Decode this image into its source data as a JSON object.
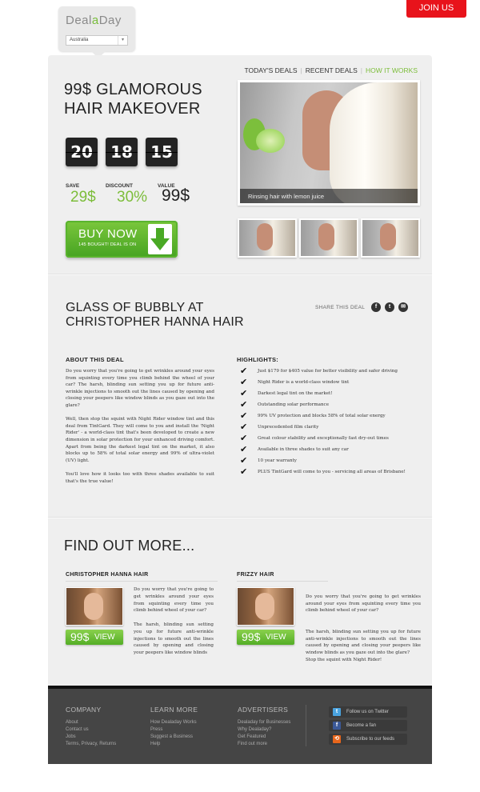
{
  "header": {
    "join_label": "JOIN US",
    "logo_part1": "Deal",
    "logo_part2": "a",
    "logo_part3": "Day",
    "country": "Australia"
  },
  "nav": {
    "items": [
      "TODAY'S DEALS",
      "RECENT DEALS",
      "HOW IT WORKS"
    ],
    "active_color": "#7cbd3a"
  },
  "deal": {
    "title": "99$ GLAMOROUS HAIR MAKEOVER",
    "timer": [
      "20",
      "18",
      "15"
    ],
    "save_label": "SAVE",
    "save_value": "29$",
    "discount_label": "DISCOUNT",
    "discount_value": "30%",
    "value_label": "VALUE",
    "value_value": "99$",
    "buy_label": "BUY NOW",
    "buy_sub": "145 BOUGHT! DEAL IS ON",
    "image_caption": "Rinsing hair with lemon juice"
  },
  "detail": {
    "title": "GLASS OF BUBBLY AT CHRISTOPHER HANNA HAIR",
    "share_label": "SHARE THIS DEAL",
    "share_icons": [
      "facebook-icon",
      "twitter-icon",
      "email-icon"
    ],
    "about_heading": "ABOUT  THIS  DEAL",
    "about_paragraphs": [
      "Do you worry that you're going to get wrinkles around your eyes from squinting every time you climb behind the wheel of your car? The harsh, blinding sun setting you up for future anti-wrinkle injections to smooth out the lines caused by opening and closing your peepers like window blinds as you gaze out into the glare?",
      "Well, then stop the squint with Night Rider window tint and this deal from TintGard. They will come to you and install the 'Night Rider' - a world-class tint that's been developed to create a new dimension in solar protection for your enhanced driving comfort. Apart from being the darkest legal tint on the market, it also blocks up to 58% of total solar energy and 99% of ultra-violet (UV) light.",
      "You'll love how it looks too with three shades available to suit that's the true value!"
    ],
    "highlights_heading": "HIGHLIGHTS:",
    "highlights": [
      "Just $179 for $405 value for better visibility and safer driving",
      "Night Rider is a world-class window tint",
      "Darkest legal tint on the market!",
      "Outstanding solar performance",
      "99% UV protection and blocks 58% of total solar energy",
      "Unprecedented film clarity",
      "Great colour stability and exceptionally fast dry-out times",
      "Available in three shades to suit any car",
      "10 year warranty",
      "PLUS TintGard will come to you - servicing all areas of Brisbane!"
    ]
  },
  "find_more": {
    "title": "FIND OUT MORE...",
    "cards": [
      {
        "heading": "CHRISTOPHER  HANNA  HAIR",
        "price": "99$",
        "view": "VIEW",
        "paragraphs": [
          "Do you worry that you're going to get wrinkles around your eyes from squinting every time you climb behind wheel of your car?",
          "The harsh, blinding sun setting you up for future anti-wrinkle injections to smooth out the lines caused by opening and closing your peepers like window blinds"
        ]
      },
      {
        "heading": "FRIZZY  HAIR",
        "price": "99$",
        "view": "VIEW",
        "paragraphs": [
          "Do you worry that you're going to get wrinkles around your eyes from squinting every time you climb behind wheel of your car?",
          "The harsh, blinding sun setting you up for future anti-wrinkle injections to smooth out the lines caused by opening and closing your peepers like window blinds as you gaze out into the glare?\nStop the squint with Night Rider!"
        ]
      }
    ]
  },
  "footer": {
    "company": {
      "heading": "COMPANY",
      "links": [
        "About",
        "Contact us",
        "Jobs",
        "Terms, Privacy, Returns"
      ]
    },
    "learn": {
      "heading": "LEARN MORE",
      "links": [
        "How Dealaday Works",
        "Press",
        "Suggest a Business",
        "Help"
      ]
    },
    "advertisers": {
      "heading": "ADVERTISERS",
      "links": [
        "Dealaday for Businesses",
        "Why Dealaday?",
        "Get Featured",
        "Find out more"
      ]
    },
    "social": [
      {
        "label": "Follow us on Twitter",
        "icon": "twitter-icon",
        "color": "#4aa3df"
      },
      {
        "label": "Become a fan",
        "icon": "facebook-icon",
        "color": "#3b5998"
      },
      {
        "label": "Subscribe to our feeds",
        "icon": "rss-icon",
        "color": "#e8661b"
      }
    ]
  },
  "colors": {
    "accent_green": "#7cbd3a",
    "join_red": "#e8131b",
    "footer_bg": "#454545"
  }
}
